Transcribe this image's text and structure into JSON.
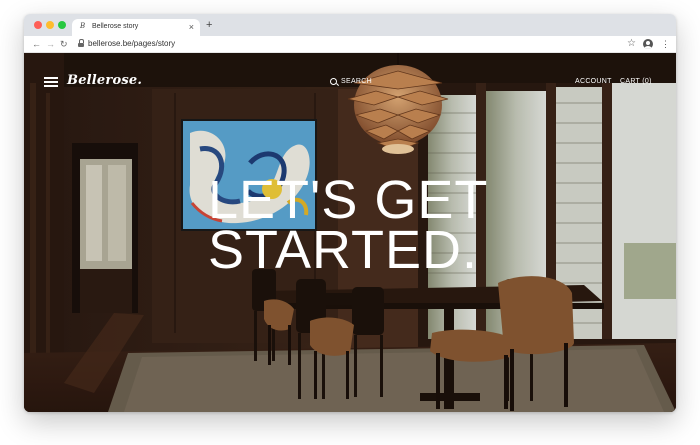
{
  "browser": {
    "tab_title": "Bellerose story",
    "tab_favicon": "B",
    "new_tab_glyph": "+",
    "close_glyph": "×",
    "url": "bellerose.be/pages/story",
    "icons": [
      "back-arrow-icon",
      "forward-arrow-icon",
      "reload-icon",
      "lock-icon",
      "star-icon",
      "profile-icon",
      "kebab-menu-icon"
    ]
  },
  "site": {
    "logo": "Bellerose.",
    "nav": {
      "search_label": "SEARCH",
      "account_label": "ACCOUNT",
      "cart_label": "CART (0)"
    },
    "hero": {
      "headline_line1": "LET'S GET",
      "headline_line2": "STARTED."
    }
  },
  "colors": {
    "tabstrip": "#dee1e6",
    "text_on_hero": "#ffffff",
    "wood": "#3a2418"
  }
}
